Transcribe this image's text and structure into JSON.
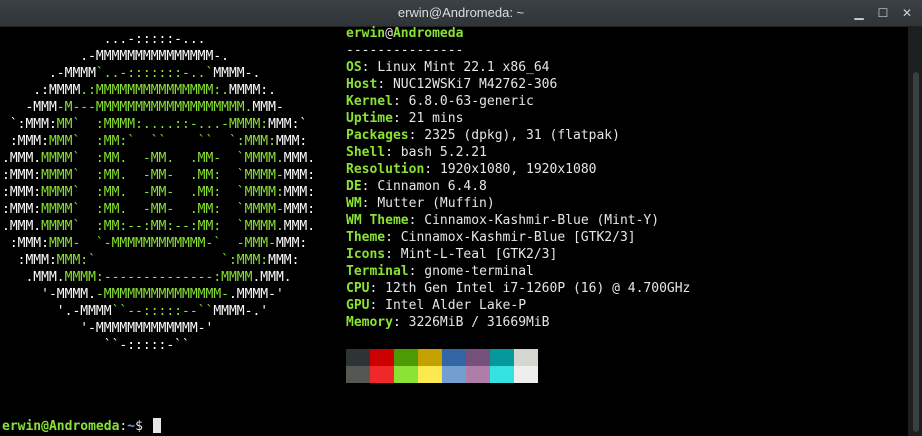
{
  "window": {
    "title": "erwin@Andromeda: ~",
    "minimize_label": "▁",
    "maximize_label": "☐",
    "close_label": "✕"
  },
  "logo_lines": [
    [
      {
        "t": "             ...-:::::-...",
        "g": false
      }
    ],
    [
      {
        "t": "          .-MMMMMMMMMMMMMMM-.",
        "g": false
      }
    ],
    [
      {
        "t": "      .-MMMM",
        "g": false
      },
      {
        "t": "`..-:::::::-..`",
        "g": true
      },
      {
        "t": "MMMM-.",
        "g": false
      }
    ],
    [
      {
        "t": "    .:MMMM",
        "g": false
      },
      {
        "t": ".:MMMMMMMMMMMMMMM:.",
        "g": true
      },
      {
        "t": "MMMM:.",
        "g": false
      }
    ],
    [
      {
        "t": "   -MMM",
        "g": false
      },
      {
        "t": "-M---MMMMMMMMMMMMMMMMMMM.",
        "g": true
      },
      {
        "t": "MMM-",
        "g": false
      }
    ],
    [
      {
        "t": " `:MMM:",
        "g": false
      },
      {
        "t": "MM`  :MMMM:....::-...-MMMM:",
        "g": true
      },
      {
        "t": "MMM:`",
        "g": false
      }
    ],
    [
      {
        "t": " :MMM:",
        "g": false
      },
      {
        "t": "MMM`  :MM:`  ``    ``  `:MMM:",
        "g": true
      },
      {
        "t": "MMM:",
        "g": false
      }
    ],
    [
      {
        "t": ".MMM.",
        "g": false
      },
      {
        "t": "MMMM`  :MM.  -MM.  .MM-  `MMMM.",
        "g": true
      },
      {
        "t": "MMM.",
        "g": false
      }
    ],
    [
      {
        "t": ":MMM:",
        "g": false
      },
      {
        "t": "MMMM`  :MM.  -MM-  .MM:  `MMMM-",
        "g": true
      },
      {
        "t": "MMM:",
        "g": false
      }
    ],
    [
      {
        "t": ":MMM:",
        "g": false
      },
      {
        "t": "MMMM`  :MM.  -MM-  .MM:  `MMMM:",
        "g": true
      },
      {
        "t": "MMM:",
        "g": false
      }
    ],
    [
      {
        "t": ":MMM:",
        "g": false
      },
      {
        "t": "MMMM`  :MM.  -MM-  .MM:  `MMMM-",
        "g": true
      },
      {
        "t": "MMM:",
        "g": false
      }
    ],
    [
      {
        "t": ".MMM.",
        "g": false
      },
      {
        "t": "MMMM`  :MM:--:MM:--:MM:  `MMMM.",
        "g": true
      },
      {
        "t": "MMM.",
        "g": false
      }
    ],
    [
      {
        "t": " :MMM:",
        "g": false
      },
      {
        "t": "MMM-  `-MMMMMMMMMMMM-`  -MMM-",
        "g": true
      },
      {
        "t": "MMM:",
        "g": false
      }
    ],
    [
      {
        "t": "  :MMM:",
        "g": false
      },
      {
        "t": "MMM:`                `:MMM:",
        "g": true
      },
      {
        "t": "MMM:",
        "g": false
      }
    ],
    [
      {
        "t": "   .MMM.",
        "g": false
      },
      {
        "t": "MMMM:--------------:MMMM",
        "g": true
      },
      {
        "t": ".MMM.",
        "g": false
      }
    ],
    [
      {
        "t": "     '-MMMM.",
        "g": false
      },
      {
        "t": "-MMMMMMMMMMMMMMM-",
        "g": true
      },
      {
        "t": ".MMMM-'",
        "g": false
      }
    ],
    [
      {
        "t": "       '.-MMMM",
        "g": false
      },
      {
        "t": "``--:::::--``",
        "g": true
      },
      {
        "t": "MMMM-.'",
        "g": false
      }
    ],
    [
      {
        "t": "          '-MMMMMMMMMMMMM-'",
        "g": false
      }
    ],
    [
      {
        "t": "             ``-:::::-``",
        "g": false
      }
    ]
  ],
  "info": {
    "user": "erwin",
    "at": "@",
    "host": "Andromeda",
    "separator": "---------------",
    "fields": [
      {
        "label": "OS",
        "value": "Linux Mint 22.1 x86_64"
      },
      {
        "label": "Host",
        "value": "NUC12WSKi7 M42762-306"
      },
      {
        "label": "Kernel",
        "value": "6.8.0-63-generic"
      },
      {
        "label": "Uptime",
        "value": "21 mins"
      },
      {
        "label": "Packages",
        "value": "2325 (dpkg), 31 (flatpak)"
      },
      {
        "label": "Shell",
        "value": "bash 5.2.21"
      },
      {
        "label": "Resolution",
        "value": "1920x1080, 1920x1080"
      },
      {
        "label": "DE",
        "value": "Cinnamon 6.4.8"
      },
      {
        "label": "WM",
        "value": "Mutter (Muffin)"
      },
      {
        "label": "WM Theme",
        "value": "Cinnamox-Kashmir-Blue (Mint-Y)"
      },
      {
        "label": "Theme",
        "value": "Cinnamox-Kashmir-Blue [GTK2/3]"
      },
      {
        "label": "Icons",
        "value": "Mint-L-Teal [GTK2/3]"
      },
      {
        "label": "Terminal",
        "value": "gnome-terminal"
      },
      {
        "label": "CPU",
        "value": "12th Gen Intel i7-1260P (16) @ 4.700GHz"
      },
      {
        "label": "GPU",
        "value": "Intel Alder Lake-P"
      },
      {
        "label": "Memory",
        "value": "3226MiB / 31669MiB"
      }
    ]
  },
  "palette": {
    "normal": [
      "#2e3436",
      "#cc0000",
      "#4e9a06",
      "#c4a000",
      "#3465a4",
      "#75507b",
      "#06989a",
      "#d3d7cf"
    ],
    "bright": [
      "#555753",
      "#ef2929",
      "#8ae234",
      "#fce94f",
      "#729fcf",
      "#ad7fa8",
      "#34e2e2",
      "#eeeeec"
    ]
  },
  "prompt": {
    "user_host": "erwin@Andromeda",
    "colon": ":",
    "path": "~",
    "symbol": "$ "
  }
}
